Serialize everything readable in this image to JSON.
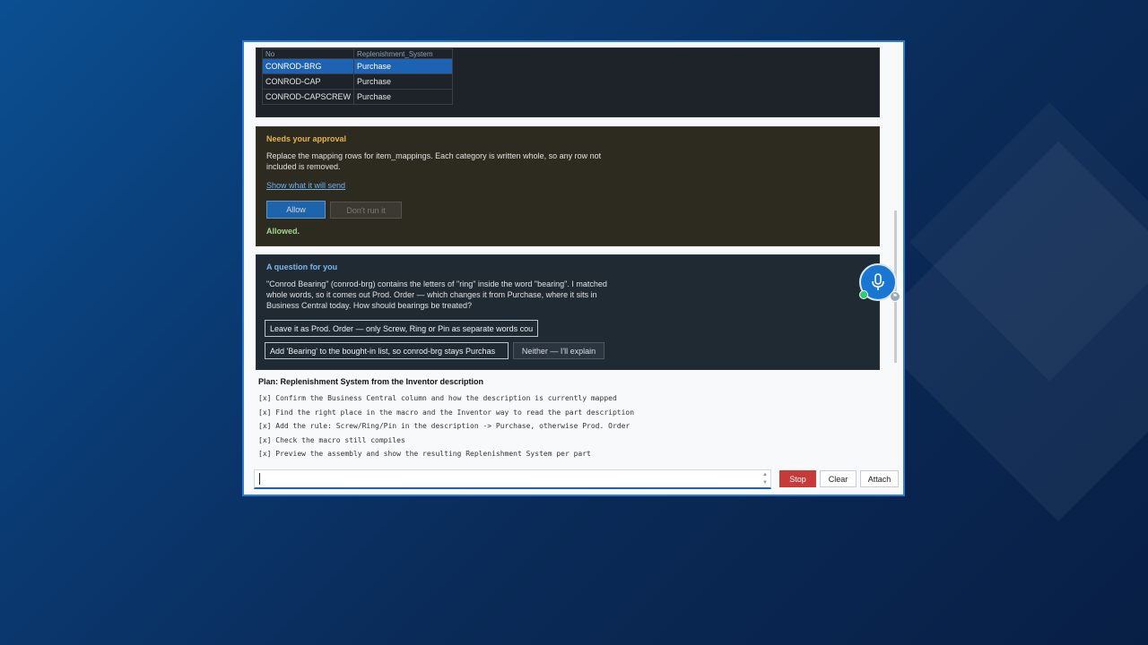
{
  "table": {
    "header": [
      "No",
      "Replenishment_System"
    ],
    "rows": [
      {
        "no": "CONROD-BRG",
        "system": "Purchase"
      },
      {
        "no": "CONROD-CAP",
        "system": "Purchase"
      },
      {
        "no": "CONROD-CAPSCREW",
        "system": "Purchase"
      }
    ]
  },
  "approval": {
    "title": "Needs your approval",
    "text": "Replace the mapping rows for item_mappings. Each category is written whole, so any row not included is removed.",
    "link": "Show what it will send",
    "allow_label": "Allow",
    "dont_label": "Don't run it",
    "status": "Allowed."
  },
  "question": {
    "title": "A question for you",
    "text": "\"Conrod Bearing\" (conrod-brg) contains the letters of \"ring\" inside the word \"bearing\". I matched whole words, so it comes out Prod. Order — which changes it from Purchase, where it sits in Business Central today. How should bearings be treated?",
    "options": [
      "Leave it as Prod. Order — only Screw, Ring or Pin as separate words cou",
      "Add 'Bearing' to the bought-in list, so conrod-brg stays Purchas",
      "Neither — I'll explain"
    ]
  },
  "plan": {
    "title": "Plan: Replenishment System from the Inventor description",
    "items": [
      "[x] Confirm the Business Central column and how the description is currently mapped",
      "[x] Find the right place in the macro and the Inventor way to read the part description",
      "[x] Add the rule: Screw/Ring/Pin in the description -> Purchase, otherwise Prod. Order",
      "[x] Check the macro still compiles",
      "[x] Preview the assembly and show the resulting Replenishment System per part"
    ]
  },
  "input": {
    "value": ""
  },
  "controls": {
    "stop": "Stop",
    "clear": "Clear",
    "attach": "Attach"
  },
  "icons": {
    "mic": "microphone-icon"
  },
  "colors": {
    "accent": "#1976d2",
    "stop": "#c73a3a",
    "approval_title": "#e3b54b",
    "question_title": "#7fb6ea"
  }
}
